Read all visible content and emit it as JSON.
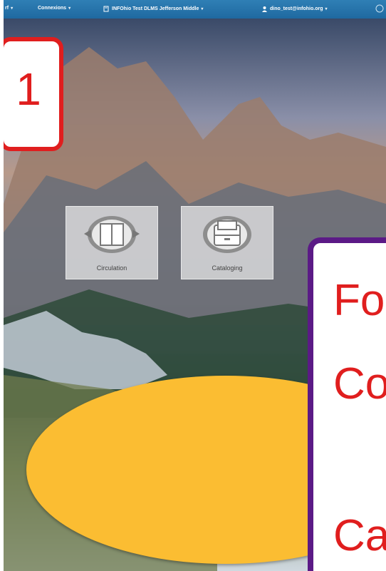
{
  "topbar": {
    "left_fragment": "rf",
    "connections_label": "Connexions",
    "location_label": "INFOhio Test DLMS Jefferson Middle",
    "user_email": "dino_test@infohio.org"
  },
  "tiles": {
    "circulation_label": "Circulation",
    "cataloging_label": "Cataloging"
  },
  "annotation": {
    "step_number": "1",
    "callout_line1": "Fo",
    "callout_line2": "Co",
    "callout_line3": "Ca"
  },
  "colors": {
    "topbar": "#1f69a0",
    "badge_border": "#e01e1e",
    "callout_border": "#5b1a86",
    "callout_text": "#e01e1e",
    "ellipse_fill": "#fbbd32"
  },
  "icons": [
    "caret-down-icon",
    "location-icon",
    "user-icon",
    "circulation-icon",
    "cataloging-icon",
    "clear-icon"
  ]
}
